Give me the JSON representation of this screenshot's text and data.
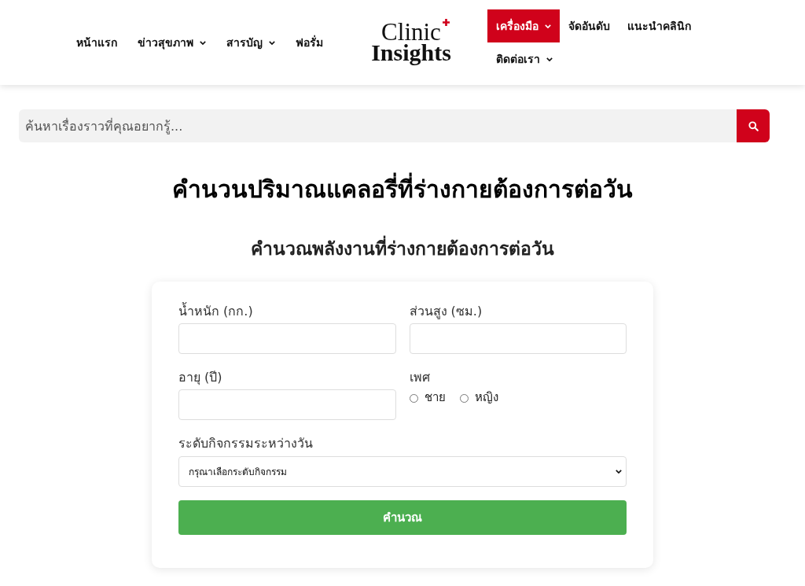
{
  "nav_left": [
    {
      "label": "หน้าแรก",
      "has_dropdown": false,
      "selected": false
    },
    {
      "label": "ข่าวสุขภาพ",
      "has_dropdown": true,
      "selected": false
    },
    {
      "label": "สารบัญ",
      "has_dropdown": true,
      "selected": false
    },
    {
      "label": "ฟอรั่ม",
      "has_dropdown": false,
      "selected": false
    }
  ],
  "logo": {
    "line_1": "Clinic",
    "line_2": "Insights"
  },
  "nav_right": [
    {
      "label": "เครื่องมือ",
      "has_dropdown": true,
      "selected": true
    },
    {
      "label": "จัดอันดับ",
      "has_dropdown": false,
      "selected": false
    },
    {
      "label": "แนะนำคลินิก",
      "has_dropdown": false,
      "selected": false
    },
    {
      "label": "ติดต่อเรา",
      "has_dropdown": true,
      "selected": false
    }
  ],
  "search": {
    "placeholder": "ค้นหาเรื่องราวที่คุณอยากรู้..."
  },
  "title": "คำนวนปริมาณแคลอรี่ที่ร่างกายต้องการต่อวัน",
  "subtitle": "คำนวณพลังงานที่ร่างกายต้องการต่อวัน",
  "form": {
    "fields": [
      {
        "kind": "text",
        "label": "น้ำหนัก (กก.)"
      },
      {
        "kind": "text",
        "label": "ส่วนสูง (ซม.)"
      },
      {
        "kind": "text",
        "label": "อายุ (ปี)"
      },
      {
        "kind": "radio",
        "label": "เพศ",
        "options": [
          {
            "label": "ชาย",
            "selected": false
          },
          {
            "label": "หญิง",
            "selected": false
          }
        ]
      },
      {
        "kind": "select",
        "label": "ระดับกิจกรรมระหว่างวัน",
        "value": "กรุณาเลือกระดับกิจกรรม"
      }
    ],
    "submit": "คำนวณ"
  }
}
